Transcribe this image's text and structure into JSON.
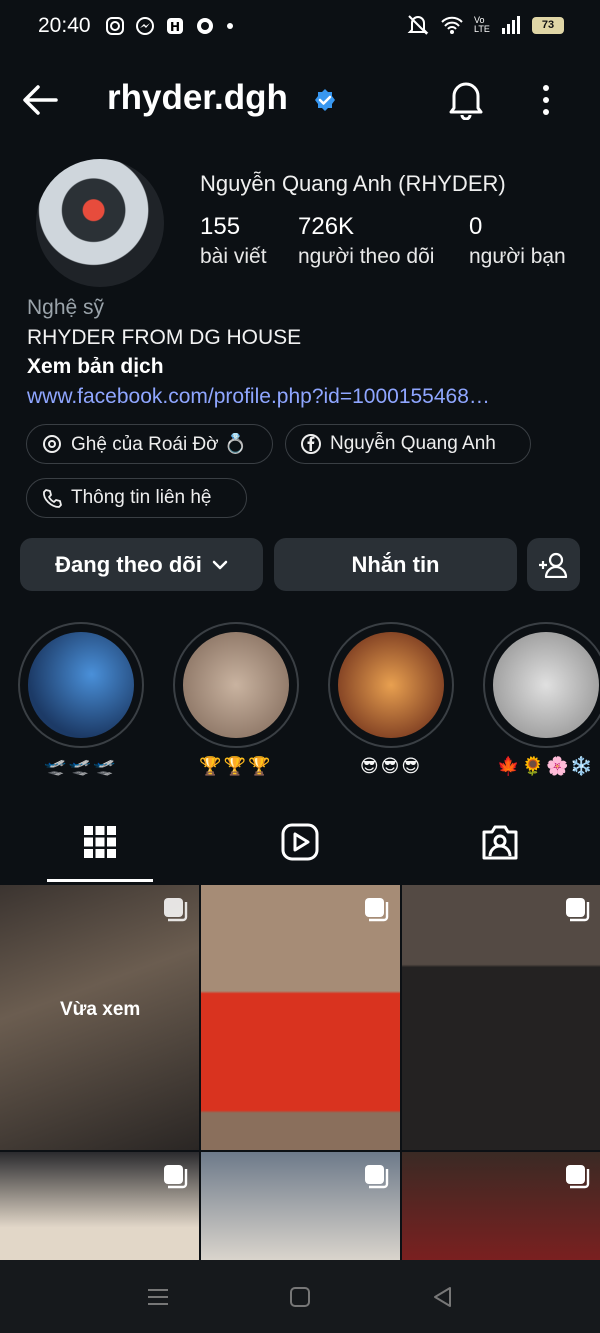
{
  "status_bar": {
    "time": "20:40",
    "battery": "73",
    "volte": "Vo LTE"
  },
  "header": {
    "username": "rhyder.dgh"
  },
  "profile": {
    "full_name": "Nguyễn Quang Anh (RHYDER)",
    "stats": [
      {
        "value": "155",
        "label": "bài viết"
      },
      {
        "value": "726K",
        "label": "người theo dõi"
      },
      {
        "value": "0",
        "label": "người bạn"
      }
    ],
    "category": "Nghệ sỹ",
    "bio": "RHYDER FROM DG HOUSE",
    "translate_label": "Xem bản dịch",
    "link": "www.facebook.com/profile.php?id=1000155468…"
  },
  "chips": [
    {
      "label": "Ghệ của Roái Đờ 💍",
      "icon": "threads-icon"
    },
    {
      "label": "Nguyễn Quang Anh",
      "icon": "facebook-icon"
    },
    {
      "label": "Thông tin liên hệ",
      "icon": "phone-icon"
    }
  ],
  "actions": {
    "follow_label": "Đang theo dõi",
    "message_label": "Nhắn tin"
  },
  "highlights": [
    {
      "label": "🛫🛫🛫",
      "color": "#2a5a8f"
    },
    {
      "label": "🏆🏆🏆",
      "color": "#b8a393"
    },
    {
      "label": "😎😎😎",
      "color": "#c77a3a"
    },
    {
      "label": "🍁🌻🌸❄️",
      "color": "#c9c9c9"
    }
  ],
  "grid": {
    "seen_label": "Vừa xem"
  },
  "colors": {
    "background": "#0c1014",
    "button": "#2a3036",
    "link": "#8fa6ff",
    "verified": "#3897f0"
  }
}
